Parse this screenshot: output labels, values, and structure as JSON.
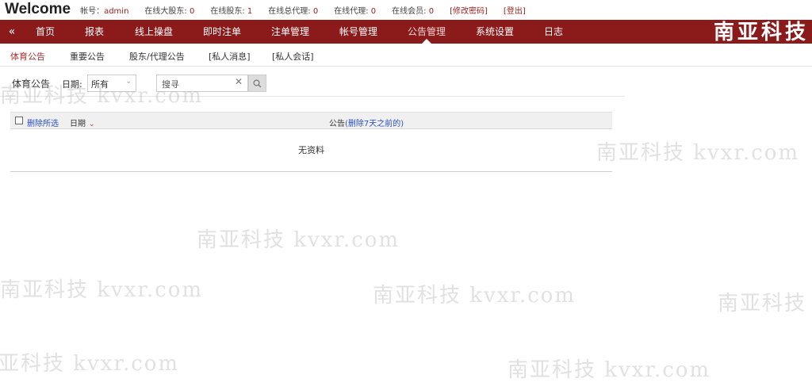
{
  "header": {
    "welcome": "Welcome",
    "stats": [
      {
        "label": "帐号：",
        "value": "admin"
      },
      {
        "label": "在线大股东: ",
        "value": "0"
      },
      {
        "label": "在线股东: ",
        "value": "1"
      },
      {
        "label": "在线总代理: ",
        "value": "0"
      },
      {
        "label": "在线代理: ",
        "value": "0"
      },
      {
        "label": "在线会员: ",
        "value": "0"
      }
    ],
    "change_password": "[修改密码]",
    "logout": "[登出]"
  },
  "nav": {
    "collapse": "«",
    "items": [
      "首页",
      "报表",
      "线上操盘",
      "即时注单",
      "注单管理",
      "帐号管理",
      "公告管理",
      "系统设置",
      "日志"
    ],
    "active_index": 6,
    "brand": "南亚科技",
    "color": "#8b1a1a"
  },
  "subtabs": {
    "items": [
      "体育公告",
      "重要公告",
      "股东/代理公告",
      "[私人消息]",
      "[私人会话]"
    ],
    "active_index": 0
  },
  "filter": {
    "title": "体育公告",
    "date_label": "日期:",
    "date_value": "所有",
    "search_placeholder": "搜寻",
    "clear_symbol": "✕"
  },
  "table": {
    "delete_selected": "删除所选",
    "col_date": "日期",
    "col_notice": "公告",
    "delete_7_days": "(删除7天之前的)",
    "empty_text": "无资料"
  },
  "watermark": "南亚科技 kvxr.com"
}
